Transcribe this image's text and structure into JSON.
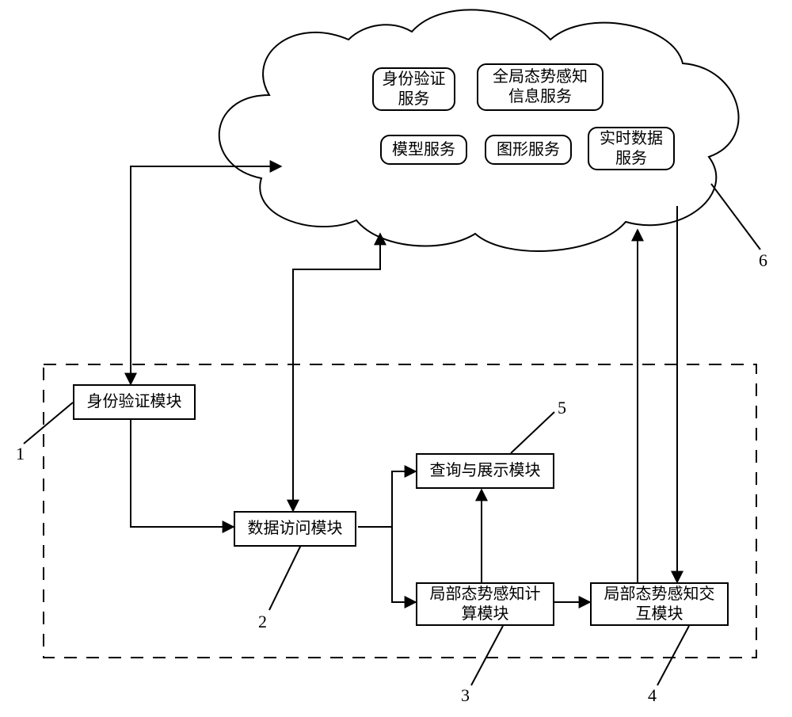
{
  "cloud": {
    "services": {
      "auth": "身份验证\n服务",
      "global": "全局态势感知\n信息服务",
      "model": "模型服务",
      "graphics": "图形服务",
      "realtime": "实时数据\n服务"
    }
  },
  "modules": {
    "auth": "身份验证模块",
    "data_access": "数据访问模块",
    "query_display": "查询与展示模块",
    "local_compute": "局部态势感知计\n算模块",
    "local_interact": "局部态势感知交\n互模块"
  },
  "refs": {
    "r1": "1",
    "r2": "2",
    "r3": "3",
    "r4": "4",
    "r5": "5",
    "r6": "6"
  }
}
